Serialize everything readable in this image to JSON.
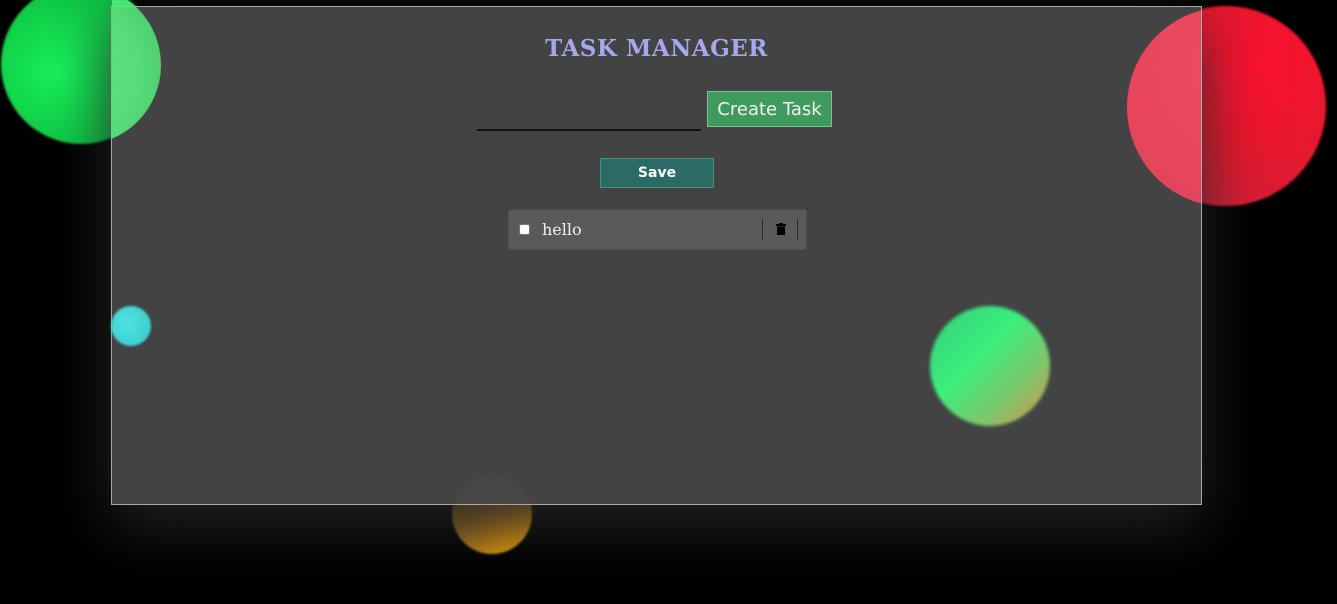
{
  "app": {
    "title": "TASK MANAGER"
  },
  "form": {
    "task_input_value": "",
    "task_input_placeholder": "",
    "create_label": "Create Task",
    "save_label": "Save"
  },
  "tasks": [
    {
      "text": "hello",
      "completed": false,
      "delete_icon": "trash-icon"
    }
  ],
  "colors": {
    "title": "#a4a8ec",
    "create_button": "#3f9a5e",
    "save_button": "#2b6b66",
    "panel": "#464646",
    "task_item": "#5a5a5a"
  }
}
